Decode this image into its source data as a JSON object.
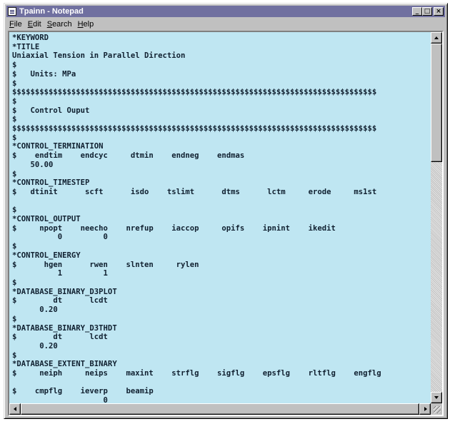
{
  "window": {
    "title": "Tpainn - Notepad"
  },
  "title_buttons": {
    "minimize": "_",
    "maximize": "□",
    "close": "×"
  },
  "menu": {
    "file": {
      "accel": "F",
      "rest": "ile"
    },
    "edit": {
      "accel": "E",
      "rest": "dit"
    },
    "search": {
      "accel": "S",
      "rest": "earch"
    },
    "help": {
      "accel": "H",
      "rest": "elp"
    }
  },
  "editor": {
    "text": "*KEYWORD\n*TITLE\nUniaxial Tension in Parallel Direction\n$\n$   Units: MPa\n$\n$$$$$$$$$$$$$$$$$$$$$$$$$$$$$$$$$$$$$$$$$$$$$$$$$$$$$$$$$$$$$$$$$$$$$$$$$$$$$$$$\n$\n$   Control Ouput\n$\n$$$$$$$$$$$$$$$$$$$$$$$$$$$$$$$$$$$$$$$$$$$$$$$$$$$$$$$$$$$$$$$$$$$$$$$$$$$$$$$$\n$\n*CONTROL_TERMINATION\n$    endtim    endcyc     dtmin    endneg    endmas\n    50.00\n$\n*CONTROL_TIMESTEP\n$   dtinit      scft      isdo    tslimt      dtms      lctm     erode     ms1st\n\n$\n*CONTROL_OUTPUT\n$     npopt    neecho    nrefup    iaccop     opifs    ipnint    ikedit\n          0         0\n$\n*CONTROL_ENERGY\n$      hgen      rwen    slnten     rylen\n          1         1\n$\n*DATABASE_BINARY_D3PLOT\n$        dt      lcdt\n      0.20\n$\n*DATABASE_BINARY_D3THDT\n$        dt      lcdt\n      0.20\n$\n*DATABASE_EXTENT_BINARY\n$     neiph     neips    maxint    strflg    sigflg    epsflg    rltflg    engflg\n\n$    cmpflg    ieverp    beamip\n                    0"
  }
}
